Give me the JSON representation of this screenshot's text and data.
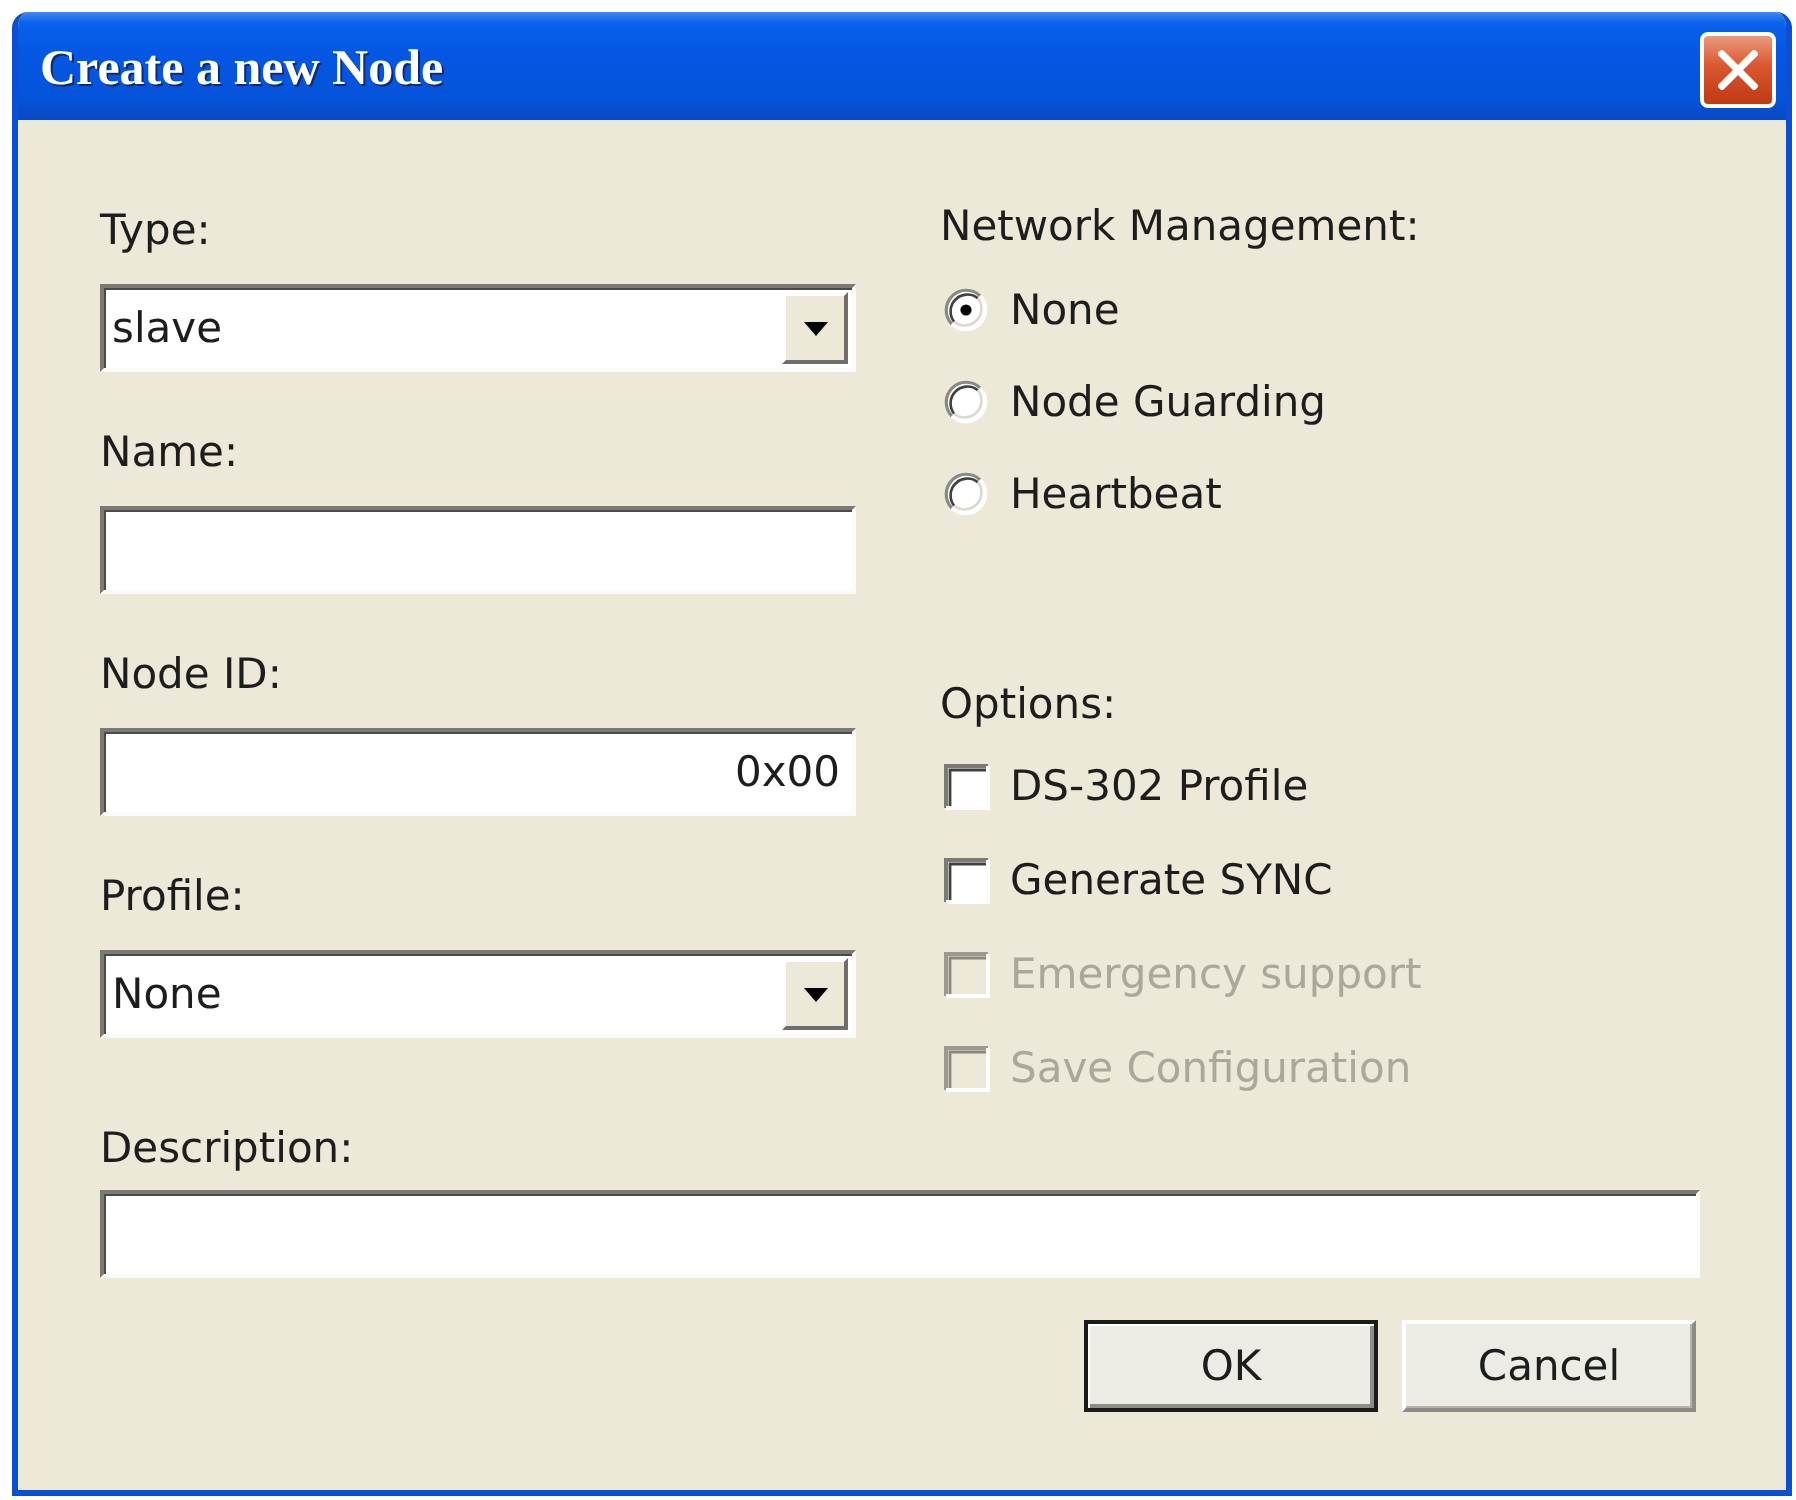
{
  "window": {
    "title": "Create a new Node"
  },
  "fields": [
    {
      "kind": "combo",
      "label": "Type:",
      "value": "slave"
    },
    {
      "kind": "text",
      "label": "Name:"
    },
    {
      "kind": "hex",
      "label": "Node ID:",
      "value": "0x00"
    },
    {
      "kind": "combo",
      "label": "Profile:",
      "value": "None"
    }
  ],
  "network_management": {
    "label": "Network Management:",
    "options": [
      {
        "label": "None",
        "selected": true
      },
      {
        "label": "Node Guarding",
        "selected": false
      },
      {
        "label": "Heartbeat",
        "selected": false
      }
    ]
  },
  "options": {
    "label": "Options:",
    "items": [
      {
        "label": "DS-302 Profile",
        "checked": false,
        "disabled": false
      },
      {
        "label": "Generate SYNC",
        "checked": false,
        "disabled": false
      },
      {
        "label": "Emergency support",
        "checked": false,
        "disabled": true
      },
      {
        "label": "Save Configuration",
        "checked": false,
        "disabled": true
      }
    ]
  },
  "description": {
    "label": "Description:"
  },
  "buttons": [
    {
      "label": "OK",
      "default": true
    },
    {
      "label": "Cancel",
      "default": false
    }
  ]
}
